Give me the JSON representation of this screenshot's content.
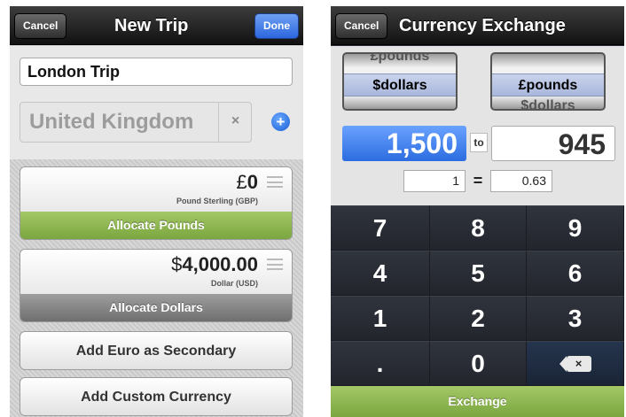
{
  "new_trip": {
    "nav": {
      "cancel": "Cancel",
      "title": "New Trip",
      "done": "Done"
    },
    "trip_name": "London Trip",
    "country": "United Kingdom",
    "clear_icon": "×",
    "add_icon": "+",
    "primary": {
      "symbol": "£",
      "value": "0",
      "subtitle": "Pound Sterling (GBP)",
      "allocate_label": "Allocate Pounds"
    },
    "secondary": {
      "symbol": "$",
      "value": "4,000.00",
      "subtitle": "Dollar (USD)",
      "allocate_label": "Allocate Dollars"
    },
    "add_euro_label": "Add Euro as Secondary",
    "add_custom_label": "Add Custom Currency"
  },
  "exchange": {
    "nav": {
      "cancel": "Cancel",
      "title": "Currency Exchange"
    },
    "from_picker": {
      "above": "£pounds",
      "selected": "$dollars"
    },
    "to_picker": {
      "selected": "£pounds",
      "below": "$dollars"
    },
    "from_amount": "1,500",
    "to_label": "to",
    "to_amount": "945",
    "rate_from": "1",
    "rate_equals": "=",
    "rate_to": "0.63",
    "keys": [
      "7",
      "8",
      "9",
      "4",
      "5",
      "6",
      "1",
      "2",
      "3",
      ".",
      "0"
    ],
    "delete_icon": "×",
    "exchange_label": "Exchange"
  },
  "colors": {
    "accent_green": "#8bb351",
    "accent_blue": "#2c6ce0",
    "keypad_dark": "#2b2e36"
  }
}
